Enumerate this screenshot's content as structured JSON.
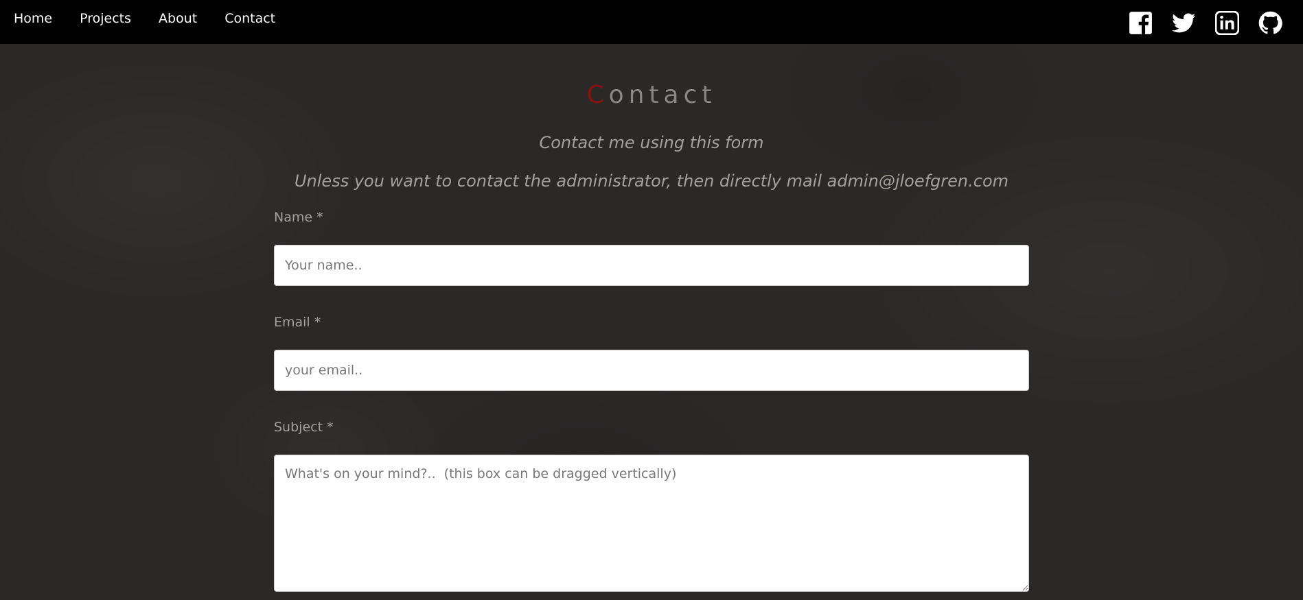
{
  "nav": {
    "links": [
      {
        "label": "Home"
      },
      {
        "label": "Projects"
      },
      {
        "label": "About"
      },
      {
        "label": "Contact"
      }
    ]
  },
  "socials": [
    {
      "icon": "facebook-icon"
    },
    {
      "icon": "twitter-icon"
    },
    {
      "icon": "linkedin-icon"
    },
    {
      "icon": "github-icon"
    }
  ],
  "page": {
    "title_first": "C",
    "title_rest": "ontact",
    "subtitle": "Contact me using this form",
    "admin_note": "Unless you want to contact the administrator, then directly mail admin@jloefgren.com"
  },
  "form": {
    "name_label": "Name *",
    "name_placeholder": "Your name..",
    "email_label": "Email *",
    "email_placeholder": "your email..",
    "subject_label": "Subject *",
    "subject_placeholder": "What's on your mind?..  (this box can be dragged vertically)"
  },
  "colors": {
    "navbar_bg": "#000000",
    "page_bg": "#2b2928",
    "title_accent": "#8c1010",
    "title_text": "#8a8683",
    "muted_text": "#a3a09d"
  }
}
